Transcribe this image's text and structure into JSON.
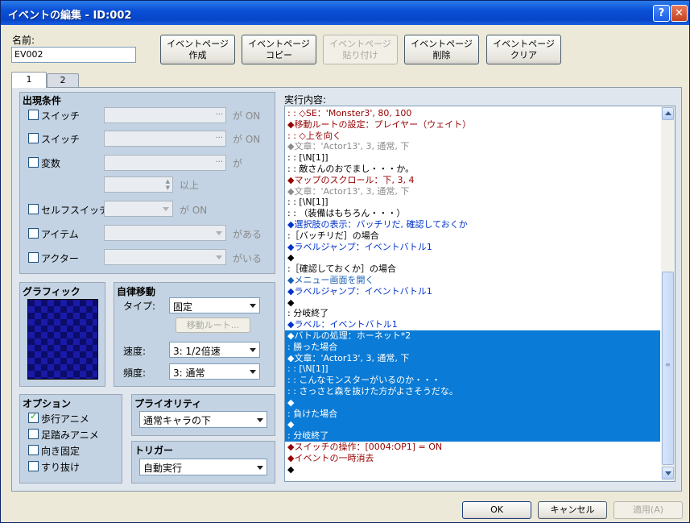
{
  "window": {
    "title": "イベントの編集 - ID:002",
    "help_label": "?",
    "close_label": "✕"
  },
  "name": {
    "label": "名前:",
    "value": "EV002"
  },
  "page_buttons": [
    {
      "label": "イベントページ\n作成",
      "enabled": true
    },
    {
      "label": "イベントページ\nコピー",
      "enabled": true
    },
    {
      "label": "イベントページ\n貼り付け",
      "enabled": false
    },
    {
      "label": "イベントページ\n削除",
      "enabled": true
    },
    {
      "label": "イベントページ\nクリア",
      "enabled": true
    }
  ],
  "tabs": [
    {
      "label": "1"
    },
    {
      "label": "2"
    }
  ],
  "conditions": {
    "title": "出現条件",
    "switch1": {
      "label": "スイッチ",
      "suffix": "が ON",
      "dots": "..."
    },
    "switch2": {
      "label": "スイッチ",
      "suffix": "が ON",
      "dots": "..."
    },
    "variable": {
      "label": "変数",
      "suffix": "が",
      "suffix2": "以上",
      "dots": "..."
    },
    "self_switch": {
      "label": "セルフスイッチ",
      "suffix": "が ON"
    },
    "item": {
      "label": "アイテム",
      "suffix": "がある"
    },
    "actor": {
      "label": "アクター",
      "suffix": "がいる"
    }
  },
  "graphic": {
    "title": "グラフィック"
  },
  "autonomous": {
    "title": "自律移動",
    "type_label": "タイプ:",
    "type_value": "固定",
    "route_button": "移動ルート...",
    "speed_label": "速度:",
    "speed_value": "3: 1/2倍速",
    "freq_label": "頻度:",
    "freq_value": "3: 通常"
  },
  "options": {
    "title": "オプション",
    "items": [
      {
        "label": "歩行アニメ",
        "checked": true
      },
      {
        "label": "足踏みアニメ",
        "checked": false
      },
      {
        "label": "向き固定",
        "checked": false
      },
      {
        "label": "すり抜け",
        "checked": false
      }
    ]
  },
  "priority": {
    "title": "プライオリティ",
    "value": "通常キャラの下"
  },
  "trigger": {
    "title": "トリガー",
    "value": "自動実行"
  },
  "content": {
    "label": "実行内容:",
    "rows": [
      {
        "text": ":               : ◇SE：'Monster3', 80, 100",
        "color": "maroon",
        "sel": false
      },
      {
        "text": "◆移動ルートの設定：プレイヤー（ウェイト）",
        "color": "maroon",
        "sel": false
      },
      {
        "text": ":               : ◇上を向く",
        "color": "maroon",
        "sel": false
      },
      {
        "text": "◆文章：'Actor13', 3, 通常, 下",
        "color": "gray",
        "sel": false
      },
      {
        "text": ":       : [\\N[1]]",
        "color": "black",
        "sel": false
      },
      {
        "text": ":       : 敵さんのおでまし・・・か。",
        "color": "black",
        "sel": false
      },
      {
        "text": "◆マップのスクロール：下, 3, 4",
        "color": "maroon",
        "sel": false
      },
      {
        "text": "◆文章：'Actor13', 3, 通常, 下",
        "color": "gray",
        "sel": false
      },
      {
        "text": ":       : [\\N[1]]",
        "color": "black",
        "sel": false
      },
      {
        "text": ":       : （装備はもちろん・・・）",
        "color": "black",
        "sel": false
      },
      {
        "text": "◆選択肢の表示：バッチリだ, 確認しておくか",
        "color": "blue",
        "sel": false
      },
      {
        "text": ":［バッチリだ］の場合",
        "color": "black",
        "sel": false
      },
      {
        "text": "  ◆ラベルジャンプ：イベントバトル1",
        "color": "blue",
        "sel": false
      },
      {
        "text": "  ◆",
        "color": "black",
        "sel": false
      },
      {
        "text": ":［確認しておくか］の場合",
        "color": "black",
        "sel": false
      },
      {
        "text": "  ◆メニュー画面を開く",
        "color": "teal",
        "sel": false
      },
      {
        "text": "  ◆ラベルジャンプ：イベントバトル1",
        "color": "blue",
        "sel": false
      },
      {
        "text": "  ◆",
        "color": "black",
        "sel": false
      },
      {
        "text": ": 分岐終了",
        "color": "black",
        "sel": false
      },
      {
        "text": "◆ラベル：イベントバトル1",
        "color": "blue",
        "sel": false
      },
      {
        "text": "◆バトルの処理：ホーネット*2",
        "color": "white",
        "sel": true
      },
      {
        "text": ": 勝った場合",
        "color": "white",
        "sel": true
      },
      {
        "text": "  ◆文章：'Actor13', 3, 通常, 下",
        "color": "white",
        "sel": true
      },
      {
        "text": "  :       : [\\N[1]]",
        "color": "white",
        "sel": true
      },
      {
        "text": "  :       : こんなモンスターがいるのか・・・",
        "color": "white",
        "sel": true
      },
      {
        "text": "  :       : さっさと森を抜けた方がよさそうだな。",
        "color": "white",
        "sel": true
      },
      {
        "text": "  ◆",
        "color": "white",
        "sel": true
      },
      {
        "text": ": 負けた場合",
        "color": "white",
        "sel": true
      },
      {
        "text": "  ◆",
        "color": "white",
        "sel": true
      },
      {
        "text": ": 分岐終了",
        "color": "white",
        "sel": true
      },
      {
        "text": "◆スイッチの操作：[0004:OP1] = ON",
        "color": "maroon",
        "sel": false
      },
      {
        "text": "◆イベントの一時消去",
        "color": "maroon",
        "sel": false
      },
      {
        "text": "◆",
        "color": "black",
        "sel": false
      }
    ]
  },
  "footer": {
    "ok": "OK",
    "cancel": "キャンセル",
    "apply": "適用(A)"
  }
}
